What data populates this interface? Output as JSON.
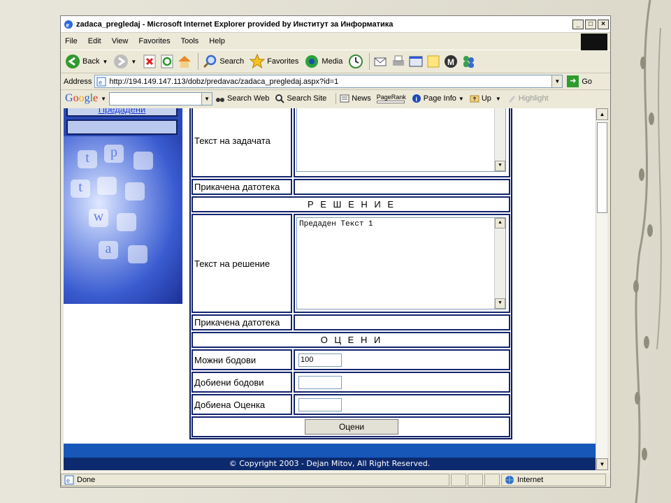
{
  "window": {
    "title": "zadaca_pregledaj - Microsoft Internet Explorer provided by Институт за Информатика"
  },
  "menu": [
    "File",
    "Edit",
    "View",
    "Favorites",
    "Tools",
    "Help"
  ],
  "toolbar": {
    "back": "Back",
    "search": "Search",
    "favorites": "Favorites",
    "media": "Media"
  },
  "address": {
    "label": "Address",
    "url": "http://194.149.147.113/dobz/predavac/zadaca_pregledaj.aspx?id=1",
    "go": "Go"
  },
  "googlebar": {
    "logo": "Google",
    "search_web": "Search Web",
    "search_site": "Search Site",
    "news": "News",
    "pagerank": "PageRank",
    "page_info": "Page Info",
    "up": "Up",
    "highlight": "Highlight"
  },
  "left": {
    "link": "Предадени"
  },
  "form": {
    "task_text_label": "Текст на задачата",
    "task_attachment_label": "Прикачена датотека",
    "solution_header": "Р Е Ш Е Н И Е",
    "solution_text_label": "Текст на решение",
    "solution_text_value": "Предаден Текст 1",
    "solution_attachment_label": "Прикачена датотека",
    "grades_header": "О Ц Е Н И",
    "possible_points_label": "Можни бодови",
    "possible_points_value": "100",
    "earned_points_label": "Добиени бодови",
    "earned_points_value": "",
    "grade_label": "Добиена Оценка",
    "grade_value": "",
    "submit_label": "Оцени"
  },
  "footer": {
    "copyright": "© Copyright 2003 - Dejan Mitov, All Right Reserved."
  },
  "status": {
    "text": "Done",
    "zone": "Internet"
  }
}
